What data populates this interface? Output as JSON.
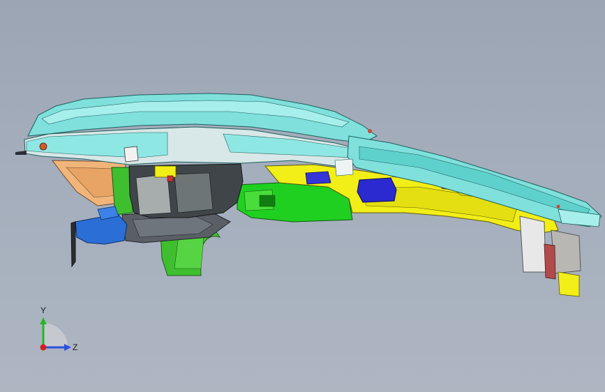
{
  "viewport": {
    "background_top": "#9ba5b4",
    "background_bottom": "#aeb6c2"
  },
  "model": {
    "colors": {
      "roof_rail": "#7fe0dc",
      "roof_rail_dark": "#4bb7b5",
      "inner_panel": "#d8e7e7",
      "wheelhouse": "#3f4548",
      "wheelhouse_light": "#a7adad",
      "wheel_arch_green": "#3fbf2f",
      "floor_green": "#1fd021",
      "sill_yellow": "#f2ee17",
      "bracket_blue": "#2b6fd6",
      "deep_blue": "#2a2ad0",
      "purple": "#7a3fc0",
      "orange_panel": "#f1b57a",
      "grey_bracket": "#5a5f66",
      "bumper_white": "#e8e8e8",
      "red_detail": "#d03030"
    }
  },
  "triad": {
    "y_label": "Y",
    "z_label": "Z",
    "y_color": "#27b627",
    "z_color": "#2b4fe0",
    "x_color": "#d02020"
  }
}
